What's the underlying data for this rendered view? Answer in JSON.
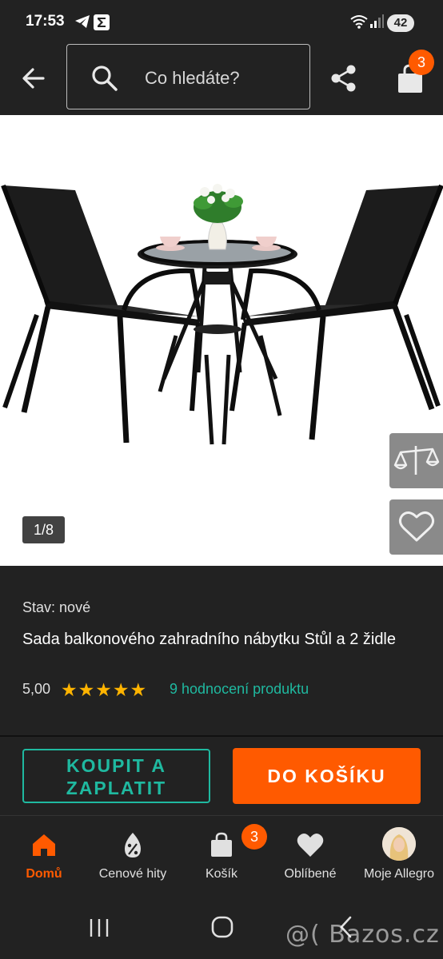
{
  "status_bar": {
    "time": "17:53",
    "battery": "42",
    "icons": [
      "telegram-icon",
      "sigma-icon",
      "wifi-icon",
      "signal-icon"
    ]
  },
  "app_bar": {
    "search_placeholder": "Co hledáte?",
    "cart_badge": "3",
    "icons": [
      "back-arrow-icon",
      "search-icon",
      "share-icon",
      "cart-bag-icon"
    ]
  },
  "gallery": {
    "counter": "1/8",
    "side_buttons": [
      "compare-scales-icon",
      "heart-icon"
    ]
  },
  "product": {
    "condition_label": "Stav:",
    "condition_value": "nové",
    "title": "Sada balkonového zahradního nábytku Stůl a 2 židle",
    "rating_value": "5,00",
    "stars": 5,
    "reviews_link": "9 hodnocení produktu"
  },
  "actions": {
    "buy_now": "KOUPIT A ZAPLATIT",
    "add_to_cart": "DO KOŠÍKU"
  },
  "bottom_nav": {
    "items": [
      {
        "label": "Domů",
        "icon": "home-icon",
        "active": true
      },
      {
        "label": "Cenové hity",
        "icon": "price-tag-icon",
        "active": false
      },
      {
        "label": "Košík",
        "icon": "cart-bag-icon",
        "active": false,
        "badge": "3"
      },
      {
        "label": "Oblíbené",
        "icon": "heart-icon",
        "active": false
      },
      {
        "label": "Moje Allegro",
        "icon": "avatar",
        "active": false
      }
    ]
  },
  "watermark": "@( Bazos.cz",
  "colors": {
    "accent": "#ff5a00",
    "teal": "#1fb9a0",
    "star": "#ffb400",
    "background": "#222222"
  }
}
